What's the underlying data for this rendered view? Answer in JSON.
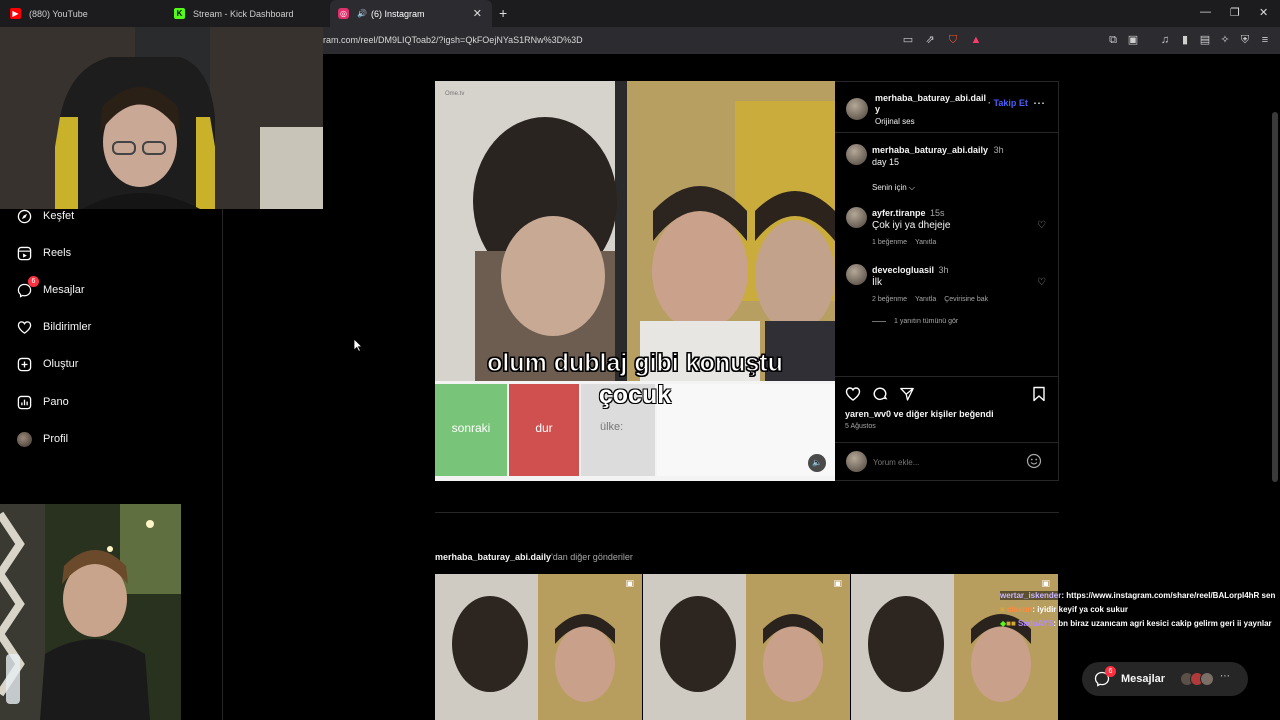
{
  "browser": {
    "tabs": [
      {
        "label": "(880) YouTube",
        "color": "#ff0000"
      },
      {
        "label": "Stream - Kick Dashboard",
        "color": "#53fc18"
      },
      {
        "label": "(6) Instagram",
        "color": "#e1306c"
      }
    ],
    "url": "ram.com/reel/DM9LIQToab2/?igsh=QkFOejNYaS1RNw%3D%3D"
  },
  "sidebar": {
    "items": [
      {
        "label": "Keşfet",
        "icon": "compass-icon"
      },
      {
        "label": "Reels",
        "icon": "reels-icon"
      },
      {
        "label": "Mesajlar",
        "icon": "messenger-icon",
        "badge": "6"
      },
      {
        "label": "Bildirimler",
        "icon": "heart-icon"
      },
      {
        "label": "Oluştur",
        "icon": "plus-square-icon"
      },
      {
        "label": "Pano",
        "icon": "chart-icon"
      },
      {
        "label": "Profil",
        "icon": "avatar"
      }
    ]
  },
  "reel": {
    "caption_line1": "olum dublaj gibi konuştu",
    "caption_line2": "çocuk",
    "btn_next": "sonraki",
    "btn_stop": "dur",
    "country_label": "ülke:",
    "watermark": "Ome.tv"
  },
  "post": {
    "author": "merhaba_baturay_abi.dail",
    "author_wrap": "y",
    "follow": "Takip Et",
    "audio": "Orijinal ses",
    "caption_author": "merhaba_baturay_abi.daily",
    "caption_time": "3h",
    "caption_text": "day 15",
    "sort_label": "Senin için",
    "comments": [
      {
        "user": "ayfer.tiranpe",
        "time": "15s",
        "text": "Çok iyi ya dhejeje",
        "likes": "1 beğenme",
        "reply": "Yanıtla",
        "translate": ""
      },
      {
        "user": "deveclogluasil",
        "time": "3h",
        "text": "İlk",
        "likes": "2 beğenme",
        "reply": "Yanıtla",
        "translate": "Çevirisine bak"
      }
    ],
    "view_replies": "1 yanıtın tümünü gör",
    "liked_by_user": "yaren_wv0",
    "liked_by_rest": " ve diğer kişiler beğendi",
    "date": "5 Ağustos",
    "comment_placeholder": "Yorum ekle..."
  },
  "more_posts": {
    "author": "merhaba_baturay_abi.daily",
    "suffix": "'dan diğer gönderiler"
  },
  "chat": [
    {
      "user": "wertar_iskender",
      "text": ": https://www.instagram.com/share/reel/BALorpI4hR sen",
      "color": "#c9b6ff"
    },
    {
      "user": "claxon",
      "text": ": iyidir keyif ya cok sukur",
      "color": "#ff8a3d"
    },
    {
      "user": "SadoAYS",
      "text": ": bn biraz uzanıcam agri kesici cakip gelirm geri ii yaynlar",
      "color": "#b48cff"
    }
  ],
  "dm_pill": {
    "label": "Mesajlar",
    "badge": "6"
  }
}
